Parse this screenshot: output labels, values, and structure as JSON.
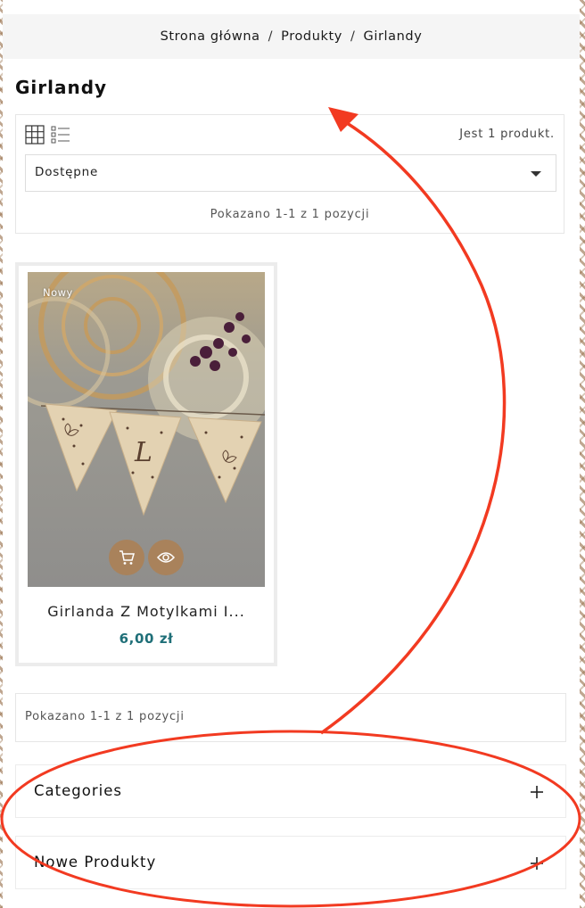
{
  "breadcrumb": {
    "items": [
      "Strona główna",
      "Produkty",
      "Girlandy"
    ],
    "separator": "/"
  },
  "page_title": "Girlandy",
  "toolbar": {
    "grid_icon": "grid-view-icon",
    "list_icon": "list-view-icon",
    "product_count": "Jest 1 produkt.",
    "sort_selected": "Dostępne",
    "showing": "Pokazano 1-1 z 1 pozycji"
  },
  "products": [
    {
      "badge": "Nowy",
      "name": "Girlanda Z Motylkami I...",
      "price": "6,00 zł",
      "cart_icon": "cart-icon",
      "quick_view_icon": "eye-icon"
    }
  ],
  "pagination": {
    "showing": "Pokazano 1-1 z 1 pozycji"
  },
  "sidebar": {
    "sections": [
      {
        "label": "Categories",
        "icon": "plus-icon"
      },
      {
        "label": "Nowe Produkty",
        "icon": "plus-icon"
      }
    ]
  },
  "colors": {
    "accent_brown": "#a9825b",
    "price_teal": "#1f6f78",
    "annotation_red": "#f23a21",
    "breadcrumb_bg": "#f5f5f5"
  }
}
